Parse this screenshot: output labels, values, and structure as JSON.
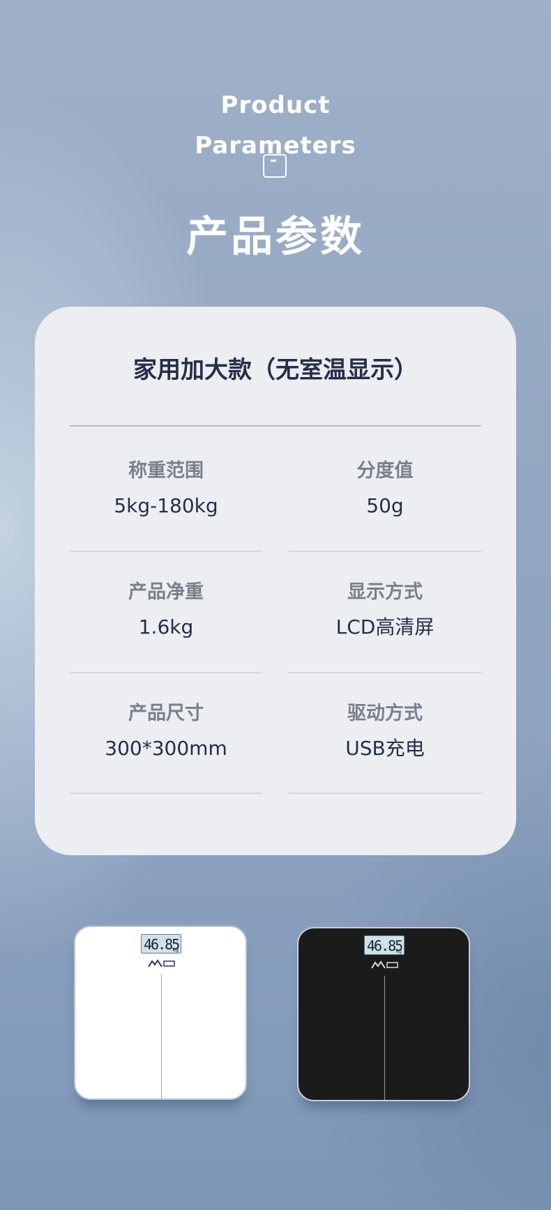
{
  "hero": {
    "title_line1": "Product",
    "title_line2": "Parameters",
    "title_cn": "产品参数",
    "icon": "square-frame-icon"
  },
  "card": {
    "title": "家用加大款（无室温显示）",
    "specs": [
      {
        "label": "称重范围",
        "value": "5kg-180kg"
      },
      {
        "label": "分度值",
        "value": "50g"
      },
      {
        "label": "产品净重",
        "value": "1.6kg"
      },
      {
        "label": "显示方式",
        "value": "LCD高清屏"
      },
      {
        "label": "产品尺寸",
        "value": "300*300mm"
      },
      {
        "label": "驱动方式",
        "value": "USB充电"
      }
    ]
  },
  "products": [
    {
      "color": "#ffffff",
      "display": "46.85",
      "unit": "kg",
      "logo": "mountain-logo-icon"
    },
    {
      "color": "#1b1b1c",
      "display": "46.85",
      "unit": "kg",
      "logo": "mountain-logo-icon"
    }
  ]
}
